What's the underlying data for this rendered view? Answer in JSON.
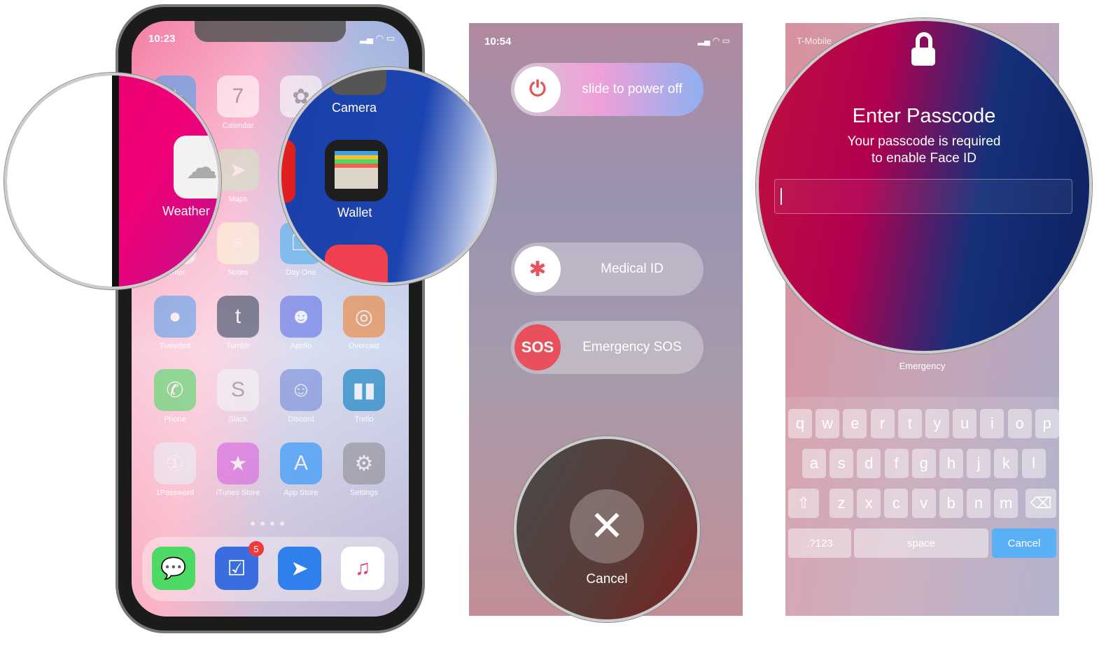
{
  "home": {
    "time": "10:23",
    "apps": [
      {
        "label": "",
        "color": "#4aa3f0",
        "icon": "safari-icon",
        "glyph": "✦"
      },
      {
        "label": "Calendar",
        "color": "#ffffff",
        "icon": "calendar-icon",
        "glyph": "7"
      },
      {
        "label": "",
        "color": "#ffffff",
        "icon": "photos-icon",
        "glyph": "✿"
      },
      {
        "label": "",
        "color": "#555555",
        "icon": "camera-icon",
        "glyph": "◉"
      },
      {
        "label": "",
        "color": "#f0f0f0",
        "icon": "weather-icon",
        "glyph": "☁"
      },
      {
        "label": "Maps",
        "color": "#cfe8c8",
        "icon": "maps-icon",
        "glyph": "➤"
      },
      {
        "label": "",
        "color": "#e02020",
        "icon": "youtube-icon",
        "glyph": "▶"
      },
      {
        "label": "",
        "color": "#222222",
        "icon": "wallet-icon",
        "glyph": "▤"
      },
      {
        "label": "Writer",
        "color": "#ffffff",
        "icon": "writer-icon",
        "glyph": "✎"
      },
      {
        "label": "Notes",
        "color": "#fff8d8",
        "icon": "notes-icon",
        "glyph": "≡"
      },
      {
        "label": "Day One",
        "color": "#4ab0f0",
        "icon": "dayone-icon",
        "glyph": "❐"
      },
      {
        "label": "",
        "color": "#f04050",
        "icon": "news-icon",
        "glyph": "N"
      },
      {
        "label": "Tweetbot",
        "color": "#5aa0e8",
        "icon": "tweetbot-icon",
        "glyph": "●"
      },
      {
        "label": "Tumblr",
        "color": "#36465d",
        "icon": "tumblr-icon",
        "glyph": "t"
      },
      {
        "label": "Apollo",
        "color": "#6070e8",
        "icon": "apollo-icon",
        "glyph": "☻"
      },
      {
        "label": "Overcast",
        "color": "#f08030",
        "icon": "overcast-icon",
        "glyph": "◎"
      },
      {
        "label": "Phone",
        "color": "#4cd964",
        "icon": "phone-icon",
        "glyph": "✆"
      },
      {
        "label": "Slack",
        "color": "#f5f5f5",
        "icon": "slack-icon",
        "glyph": "S"
      },
      {
        "label": "Discord",
        "color": "#7289da",
        "icon": "discord-icon",
        "glyph": "☺"
      },
      {
        "label": "Trello",
        "color": "#0079bf",
        "icon": "trello-icon",
        "glyph": "▮▮"
      },
      {
        "label": "1Password",
        "color": "#e8f0f8",
        "icon": "onepassword-icon",
        "glyph": "①"
      },
      {
        "label": "iTunes Store",
        "color": "#d860e0",
        "icon": "itunes-store-icon",
        "glyph": "★"
      },
      {
        "label": "App Store",
        "color": "#1e90ff",
        "icon": "app-store-icon",
        "glyph": "A"
      },
      {
        "label": "Settings",
        "color": "#8e8e93",
        "icon": "settings-icon",
        "glyph": "⚙"
      }
    ],
    "dock": [
      {
        "color": "#4cd964",
        "icon": "messages-icon",
        "glyph": "💬"
      },
      {
        "color": "#3a6ee0",
        "icon": "things-icon",
        "glyph": "☑",
        "badge": "5"
      },
      {
        "color": "#2f80ed",
        "icon": "spark-icon",
        "glyph": "➤"
      },
      {
        "color": "#ffffff",
        "icon": "music-icon",
        "glyph": "♫"
      }
    ],
    "magnified": {
      "weather": "Weather",
      "camera": "Camera",
      "wallet": "Wallet"
    }
  },
  "power": {
    "time": "10:54",
    "slide": "slide to power off",
    "medical": "Medical ID",
    "sos_badge": "SOS",
    "sos": "Emergency SOS",
    "cancel": "Cancel"
  },
  "passcode": {
    "carrier": "T-Mobile",
    "title": "Enter Passcode",
    "subtitle1": "Your passcode is required",
    "subtitle2": "to enable Face ID",
    "emergency": "Emergency",
    "rows": [
      [
        "q",
        "w",
        "e",
        "r",
        "t",
        "y",
        "u",
        "i",
        "o",
        "p"
      ],
      [
        "a",
        "s",
        "d",
        "f",
        "g",
        "h",
        "j",
        "k",
        "l"
      ],
      [
        "z",
        "x",
        "c",
        "v",
        "b",
        "n",
        "m"
      ]
    ],
    "numbers": ".?123",
    "space": "space",
    "cancel": "Cancel",
    "cancel_color": "#5ab0f5"
  }
}
